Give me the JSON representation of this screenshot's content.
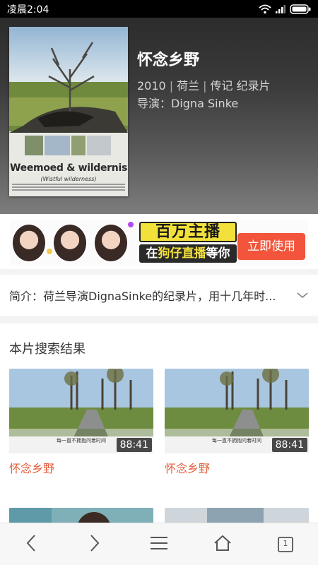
{
  "status_bar": {
    "time": "凌晨2:04",
    "icons": [
      "wifi-icon",
      "signal-icon",
      "battery-icon"
    ]
  },
  "movie": {
    "title": "怀念乡野",
    "year": "2010",
    "country": "荷兰",
    "genres": "传记 纪录片",
    "director_line": "导演：Digna Sinke",
    "poster": {
      "title": "Weemoed & wildernis",
      "subtitle": "(Wistful wilderness)"
    }
  },
  "banner": {
    "headline": "百万主播",
    "sub_prefix": "在",
    "sub_highlight": "狗仔直播",
    "sub_suffix": "等你",
    "cta": "立即使用"
  },
  "synopsis": {
    "text": "简介：荷兰导演DignaSinke的纪录片，用十几年时..."
  },
  "results": {
    "title": "本片搜索结果",
    "items": [
      {
        "title": "怀念乡野",
        "duration": "88:41",
        "caption": "每一直不拥抱问着时间"
      },
      {
        "title": "怀念乡野",
        "duration": "88:41",
        "caption": "每一直不拥抱问着时间"
      }
    ]
  },
  "nav": {
    "tab_count": "1",
    "icons": [
      "back-icon",
      "forward-icon",
      "menu-icon",
      "home-icon",
      "tabs-icon"
    ]
  },
  "colors": {
    "accent": "#e55c3a",
    "cta": "#f2553b",
    "banner_yellow": "#f2e13a"
  }
}
